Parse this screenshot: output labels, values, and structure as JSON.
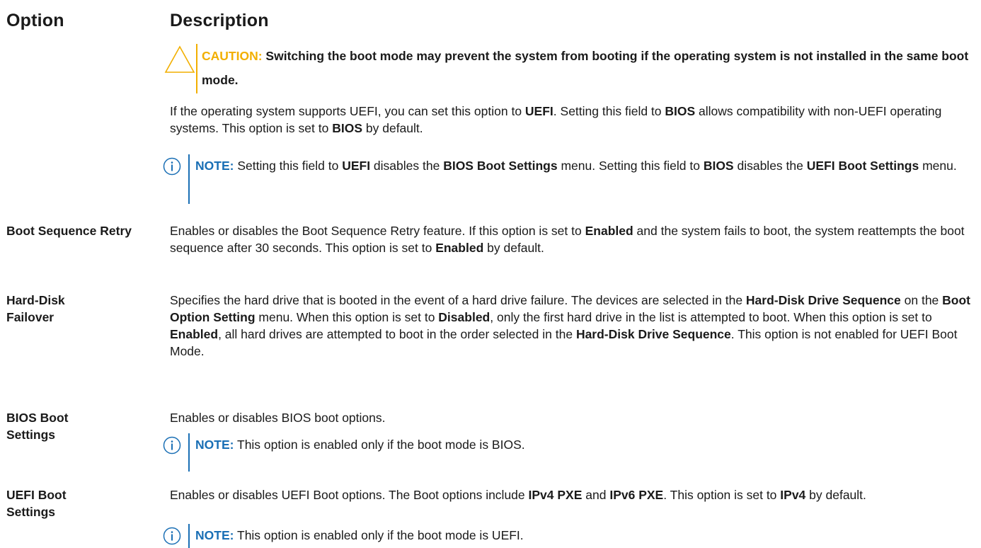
{
  "header": {
    "option": "Option",
    "description": "Description"
  },
  "caution": {
    "label": "CAUTION:",
    "text": "Switching the boot mode may prevent the system from booting if the operating system is not installed in the same boot mode."
  },
  "boot_mode": {
    "p1": "If the operating system supports UEFI, you can set this option to ",
    "b1": "UEFI",
    "p2": ". Setting this field to ",
    "b2": "BIOS",
    "p3": " allows compatibility with non-UEFI operating systems. This option is set to ",
    "b3": "BIOS",
    "p4": " by default.",
    "note": {
      "label": "NOTE:",
      "t1": " Setting this field to ",
      "b1": "UEFI",
      "t2": " disables the ",
      "b2": "BIOS Boot Settings",
      "t3": " menu. Setting this field to ",
      "b3": "BIOS",
      "t4": " disables the ",
      "b4": "UEFI Boot Settings",
      "t5": " menu."
    }
  },
  "boot_retry": {
    "option": "Boot Sequence Retry",
    "t1": "Enables or disables the Boot Sequence Retry feature. If this option is set to ",
    "b1": "Enabled",
    "t2": " and the system fails to boot, the system reattempts the boot sequence after 30 seconds. This option is set to ",
    "b2": "Enabled",
    "t3": " by default."
  },
  "hdd_failover": {
    "option": "Hard-Disk Failover",
    "t1": "Specifies the hard drive that is booted in the event of a hard drive failure. The devices are selected in the ",
    "b1": "Hard-Disk Drive Sequence",
    "t2": " on the ",
    "b2": "Boot Option Setting",
    "t3": " menu. When this option is set to ",
    "b3": "Disabled",
    "t4": ", only the first hard drive in the list is attempted to boot. When this option is set to ",
    "b4": "Enabled",
    "t5": ", all hard drives are attempted to boot in the order selected in the ",
    "b5": "Hard-Disk Drive Sequence",
    "t6": ". This option is not enabled for UEFI Boot Mode."
  },
  "bios_boot": {
    "option": "BIOS Boot Settings",
    "text": "Enables or disables BIOS boot options.",
    "note": {
      "label": "NOTE:",
      "text": " This option is enabled only if the boot mode is BIOS."
    }
  },
  "uefi_boot": {
    "option": "UEFI Boot Settings",
    "t1": "Enables or disables UEFI Boot options. The Boot options include ",
    "b1": "IPv4 PXE",
    "t2": " and ",
    "b2": "IPv6 PXE",
    "t3": ". This option is set to ",
    "b3": "IPv4",
    "t4": " by default.",
    "note": {
      "label": "NOTE:",
      "text": " This option is enabled only if the boot mode is UEFI."
    }
  },
  "colors": {
    "caution": "#f2af00",
    "note": "#1a6fb5",
    "text": "#1a1a1a"
  },
  "icons": {
    "caution": "warning-triangle-icon",
    "note": "info-circle-icon"
  }
}
